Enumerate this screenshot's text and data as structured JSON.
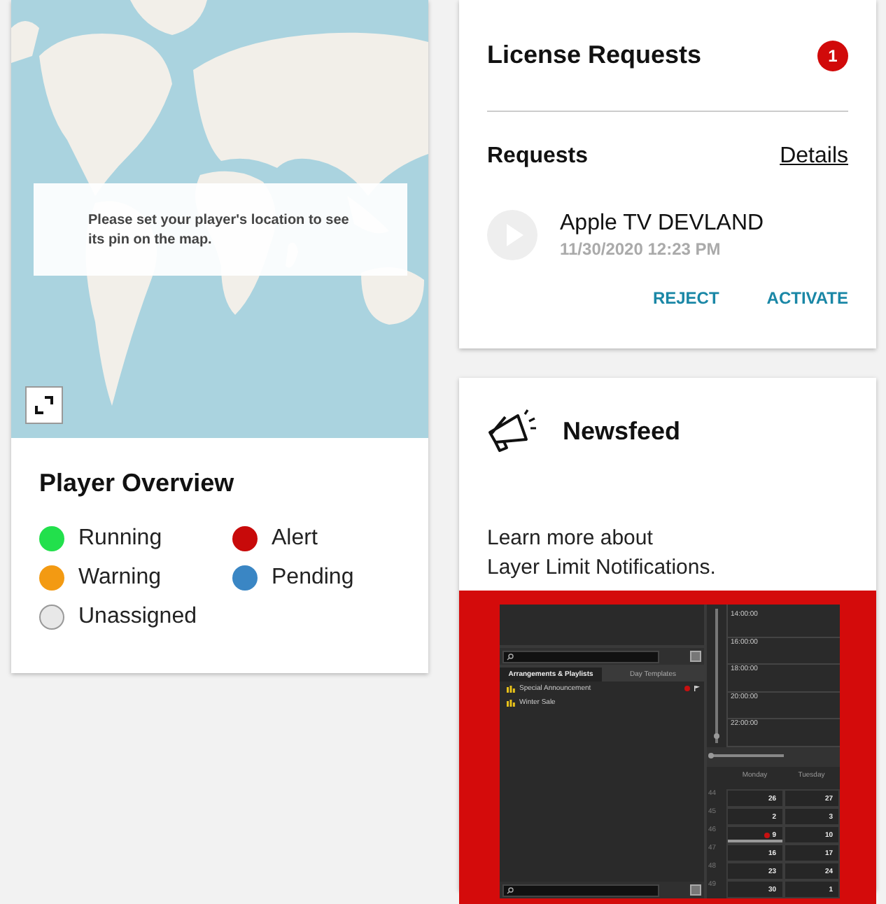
{
  "map": {
    "kind": "picture",
    "message": "Please set your player's location to see its pin on the map."
  },
  "player_overview": {
    "title": "Player Overview",
    "legend": [
      {
        "label": "Running",
        "color": "#22e04c"
      },
      {
        "label": "Alert",
        "color": "#c80a0a"
      },
      {
        "label": "Warning",
        "color": "#f39a12"
      },
      {
        "label": "Pending",
        "color": "#3a86c4"
      },
      {
        "label": "Unassigned",
        "color": "#e8e8e8"
      }
    ]
  },
  "license_requests": {
    "title": "License Requests",
    "badge": "1",
    "section_title": "Requests",
    "details_link": "Details",
    "requests": [
      {
        "name": "Apple TV DEVLAND",
        "date": "11/30/2020 12:23 PM",
        "actions": [
          "REJECT",
          "ACTIVATE"
        ]
      }
    ]
  },
  "newsfeed": {
    "title": "Newsfeed",
    "text": "Learn more about\nLayer Limit Notifications.",
    "screenshot": {
      "tabs": [
        {
          "label": "Arrangements & Playlists",
          "selected": true
        },
        {
          "label": "Day Templates",
          "selected": false
        }
      ],
      "items": [
        {
          "label": "Special Announcement",
          "alert": true
        },
        {
          "label": "Winter Sale",
          "alert": false
        }
      ],
      "vertical_slider": {
        "level": 0.05
      },
      "horizontal_slider": {
        "level": 0
      },
      "times": [
        "14:00:00",
        "16:00:00",
        "18:00:00",
        "20:00:00",
        "22:00:00"
      ],
      "columns": [
        "Monday",
        "Tuesday"
      ],
      "weeks": [
        {
          "week": "44",
          "days": [
            {
              "day": "26",
              "alert": false,
              "selected": false
            },
            {
              "day": "27",
              "alert": false,
              "selected": false
            }
          ]
        },
        {
          "week": "45",
          "days": [
            {
              "day": "2",
              "alert": false,
              "selected": false
            },
            {
              "day": "3",
              "alert": false,
              "selected": false
            }
          ]
        },
        {
          "week": "46",
          "days": [
            {
              "day": "9",
              "alert": true,
              "selected": true
            },
            {
              "day": "10",
              "alert": false,
              "selected": false
            }
          ]
        },
        {
          "week": "47",
          "days": [
            {
              "day": "16",
              "alert": false,
              "selected": false
            },
            {
              "day": "17",
              "alert": false,
              "selected": false
            }
          ]
        },
        {
          "week": "48",
          "days": [
            {
              "day": "23",
              "alert": false,
              "selected": false
            },
            {
              "day": "24",
              "alert": false,
              "selected": false
            }
          ]
        },
        {
          "week": "49",
          "days": [
            {
              "day": "30",
              "alert": false,
              "selected": false
            },
            {
              "day": "1",
              "alert": false,
              "selected": false
            }
          ]
        }
      ]
    }
  }
}
